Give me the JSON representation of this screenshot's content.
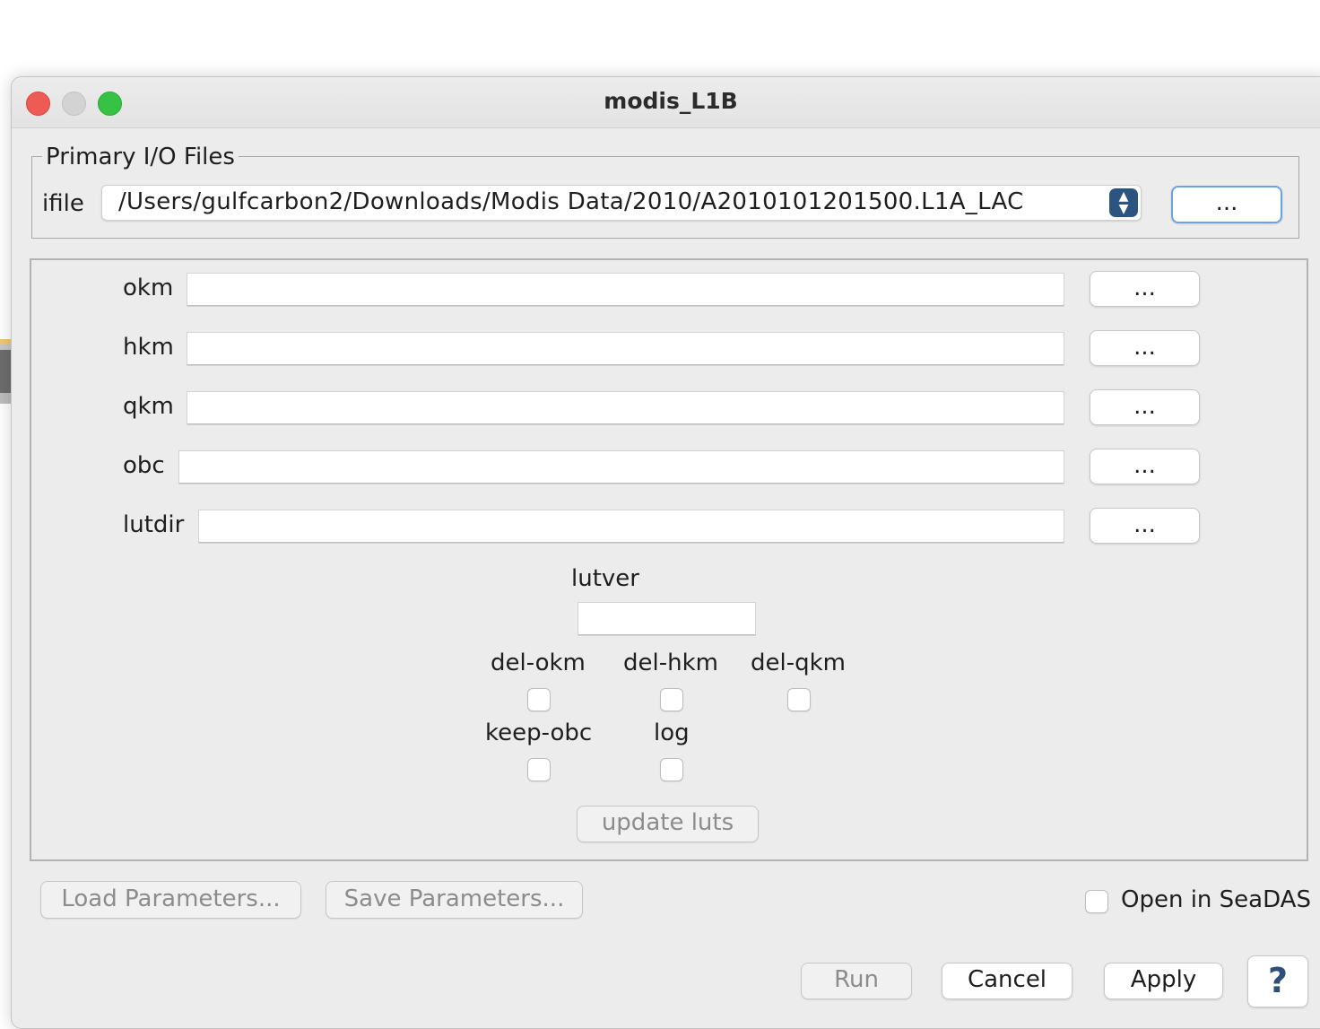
{
  "window": {
    "title": "modis_L1B"
  },
  "primary_io": {
    "group_title": "Primary I/O Files",
    "ifile_label": "ifile",
    "ifile_value": "/Users/gulfcarbon2/Downloads/Modis Data/2010/A2010101201500.L1A_LAC",
    "browse_label": "..."
  },
  "params": {
    "fields": [
      {
        "label": "okm",
        "value": "",
        "browse": "..."
      },
      {
        "label": "hkm",
        "value": "",
        "browse": "..."
      },
      {
        "label": "qkm",
        "value": "",
        "browse": "..."
      },
      {
        "label": "obc",
        "value": "",
        "browse": "..."
      },
      {
        "label": "lutdir",
        "value": "",
        "browse": "..."
      }
    ],
    "lutver_label": "lutver",
    "lutver_value": "",
    "checkboxes": [
      {
        "label": "del-okm",
        "checked": false
      },
      {
        "label": "del-hkm",
        "checked": false
      },
      {
        "label": "del-qkm",
        "checked": false
      },
      {
        "label": "keep-obc",
        "checked": false
      },
      {
        "label": "log",
        "checked": false
      }
    ],
    "update_luts_label": "update luts"
  },
  "footer": {
    "load_label": "Load Parameters...",
    "save_label": "Save Parameters...",
    "open_in_seadas_label": "Open in SeaDAS",
    "open_in_seadas_checked": false,
    "run_label": "Run",
    "cancel_label": "Cancel",
    "apply_label": "Apply",
    "help_label": "?"
  },
  "colors": {
    "window_bg": "#ececec",
    "close": "#ee5b55",
    "zoom": "#35c245",
    "focus_ring": "#6aa2e6",
    "combo_arrow": "#2c5480"
  }
}
